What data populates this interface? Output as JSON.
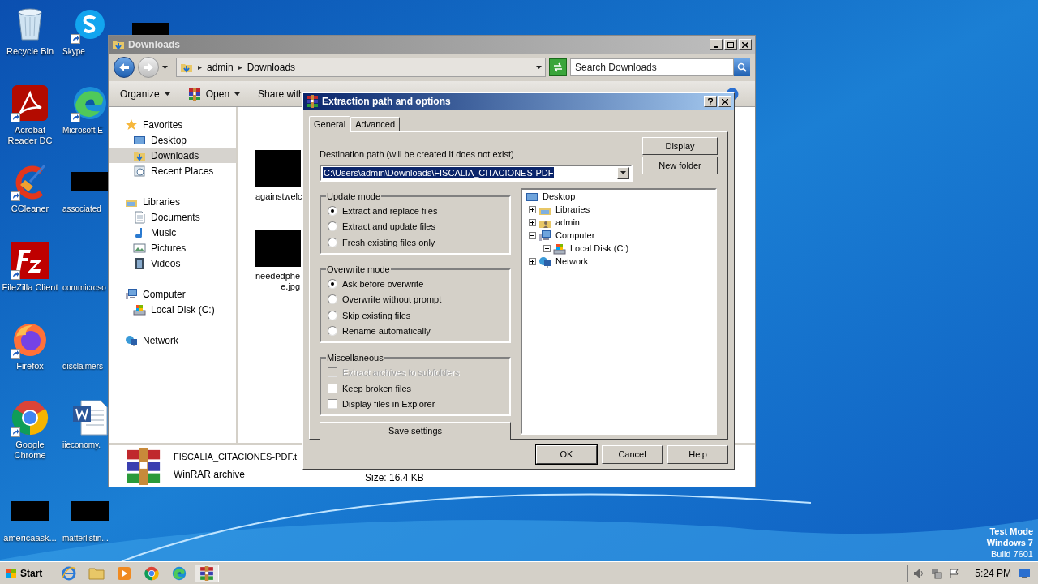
{
  "desktop_icons": [
    {
      "kind": "bin",
      "label": "Recycle Bin",
      "shortcut": false
    },
    {
      "kind": "skype",
      "label": "Skype",
      "shortcut": true
    },
    {
      "kind": "pdf",
      "label": "Acrobat Reader DC",
      "shortcut": true
    },
    {
      "kind": "edge",
      "label": "Microsoft E",
      "shortcut": true
    },
    {
      "kind": "cleaner",
      "label": "CCleaner",
      "shortcut": true
    },
    {
      "kind": "blank",
      "label": "associated",
      "shortcut": false
    },
    {
      "kind": "zilla",
      "label": "FileZilla Client",
      "shortcut": true
    },
    {
      "kind": "none",
      "label": "commicroso",
      "shortcut": false
    },
    {
      "kind": "firefox",
      "label": "Firefox",
      "shortcut": true
    },
    {
      "kind": "none",
      "label": "disclaimers",
      "shortcut": false
    },
    {
      "kind": "chrome",
      "label": "Google Chrome",
      "shortcut": true
    },
    {
      "kind": "doc",
      "label": "iieconomy.",
      "shortcut": false
    },
    {
      "kind": "blank",
      "label": "americaask...",
      "shortcut": false
    },
    {
      "kind": "blank",
      "label": "matterlistin...",
      "shortcut": false
    }
  ],
  "explorer": {
    "title": "Downloads",
    "breadcrumb": [
      "admin",
      "Downloads"
    ],
    "search": {
      "placeholder": "Search Downloads"
    },
    "toolbar": [
      {
        "kind": "plain",
        "label": "Organize"
      },
      {
        "kind": "archive",
        "label": "Open"
      },
      {
        "kind": "plain",
        "label": "Share with"
      }
    ],
    "nav": [
      {
        "kind": "star",
        "label": "Favorites",
        "children": [
          {
            "kind": "desktop",
            "label": "Desktop",
            "selected": false
          },
          {
            "kind": "download",
            "label": "Downloads",
            "selected": true
          },
          {
            "kind": "recent",
            "label": "Recent Places",
            "selected": false
          }
        ]
      },
      {
        "kind": "library",
        "label": "Libraries",
        "children": [
          {
            "kind": "document",
            "label": "Documents",
            "selected": false
          },
          {
            "kind": "music",
            "label": "Music",
            "selected": false
          },
          {
            "kind": "pictures",
            "label": "Pictures",
            "selected": false
          },
          {
            "kind": "videos",
            "label": "Videos",
            "selected": false
          }
        ]
      },
      {
        "kind": "computer",
        "label": "Computer",
        "children": [
          {
            "kind": "disk",
            "label": "Local Disk (C:)",
            "selected": false
          }
        ]
      },
      {
        "kind": "network",
        "label": "Network"
      }
    ],
    "files": [
      {
        "lines": [
          "againstwelc"
        ]
      },
      {
        "lines": [
          "neededphe",
          "e.jpg"
        ]
      }
    ],
    "details": {
      "name": "FISCALIA_CITACIONES-PDF.t",
      "type": "WinRAR archive",
      "size": "Size: 16.4 KB"
    }
  },
  "dialog": {
    "title": "Extraction path and options",
    "tabs": [
      {
        "label": "General",
        "selected": true
      },
      {
        "label": "Advanced",
        "selected": false
      }
    ],
    "destination_label": "Destination path (will be created if does not exist)",
    "destination_value": "C:\\Users\\admin\\Downloads\\FISCALIA_CITACIONES-PDF",
    "side_buttons": [
      "Display",
      "New folder"
    ],
    "groups": [
      {
        "title": "Update mode",
        "options": [
          {
            "kind": "radio",
            "label": "Extract and replace files",
            "checked": true,
            "disabled": false
          },
          {
            "kind": "radio",
            "label": "Extract and update files",
            "checked": false,
            "disabled": false
          },
          {
            "kind": "radio",
            "label": "Fresh existing files only",
            "checked": false,
            "disabled": false
          }
        ]
      },
      {
        "title": "Overwrite mode",
        "options": [
          {
            "kind": "radio",
            "label": "Ask before overwrite",
            "checked": true,
            "disabled": false
          },
          {
            "kind": "radio",
            "label": "Overwrite without prompt",
            "checked": false,
            "disabled": false
          },
          {
            "kind": "radio",
            "label": "Skip existing files",
            "checked": false,
            "disabled": false
          },
          {
            "kind": "radio",
            "label": "Rename automatically",
            "checked": false,
            "disabled": false
          }
        ]
      },
      {
        "title": "Miscellaneous",
        "options": [
          {
            "kind": "checkbox",
            "label": "Extract archives to subfolders",
            "checked": false,
            "disabled": true
          },
          {
            "kind": "checkbox",
            "label": "Keep broken files",
            "checked": false,
            "disabled": false
          },
          {
            "kind": "checkbox",
            "label": "Display files in Explorer",
            "checked": false,
            "disabled": false
          }
        ]
      }
    ],
    "save_button": "Save settings",
    "tree": [
      {
        "kind": "desktop",
        "label": "Desktop",
        "children": [
          {
            "kind": "library",
            "label": "Libraries",
            "expanded": false
          },
          {
            "kind": "user",
            "label": "admin",
            "expanded": false
          },
          {
            "kind": "computer",
            "label": "Computer",
            "expanded": true,
            "children": [
              {
                "kind": "disk",
                "label": "Local Disk (C:)",
                "expanded": false
              }
            ]
          },
          {
            "kind": "network",
            "label": "Network",
            "expanded": false
          }
        ]
      }
    ],
    "buttons": [
      {
        "label": "OK",
        "default": true
      },
      {
        "label": "Cancel",
        "default": false
      },
      {
        "label": "Help",
        "default": false
      }
    ]
  },
  "taskbar": {
    "start": "Start",
    "items": [
      {
        "kind": "ie",
        "selected": false
      },
      {
        "kind": "folder",
        "selected": false
      },
      {
        "kind": "media",
        "selected": false
      },
      {
        "kind": "chrome",
        "selected": false
      },
      {
        "kind": "edge",
        "selected": false
      },
      {
        "kind": "archive",
        "selected": true
      }
    ],
    "clock": "5:24 PM"
  },
  "watermark_lines": [
    "Test Mode",
    "Windows 7",
    "Build 7601"
  ]
}
